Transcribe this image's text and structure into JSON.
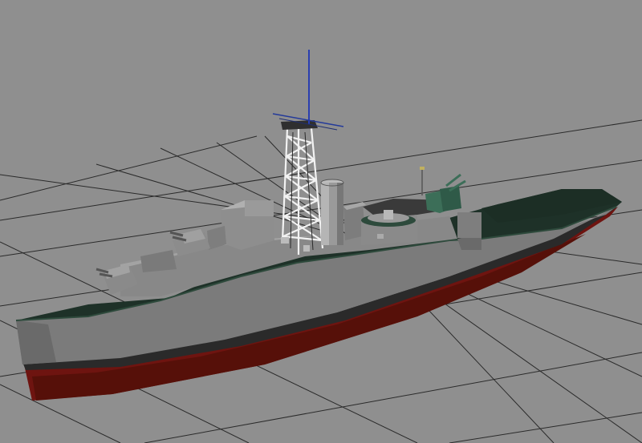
{
  "viewport": {
    "kind": "3d-perspective-viewport",
    "background_color": "#8f8f8f",
    "grid": {
      "visible": true,
      "line_color": "#2a2a2a"
    },
    "manipulator": {
      "visible": true,
      "axis_colors": {
        "vertical": "#2a3fb0",
        "horizontal": "#243a9a"
      }
    }
  },
  "model": {
    "name": "warship",
    "colors": {
      "hull_side": "#7a7a7a",
      "hull_lower": "#5e5e5e",
      "boot_topping": "#6e1410",
      "deck": "#1e3128",
      "deck_edge": "#2e4a3c",
      "superstructure": "#8a8a8a",
      "superstructure_dark": "#5d5d5d",
      "lattice_mast": "#f2f2f2",
      "funnel": "#9a9a9a",
      "gun_mount_green": "#3c6e58"
    }
  }
}
